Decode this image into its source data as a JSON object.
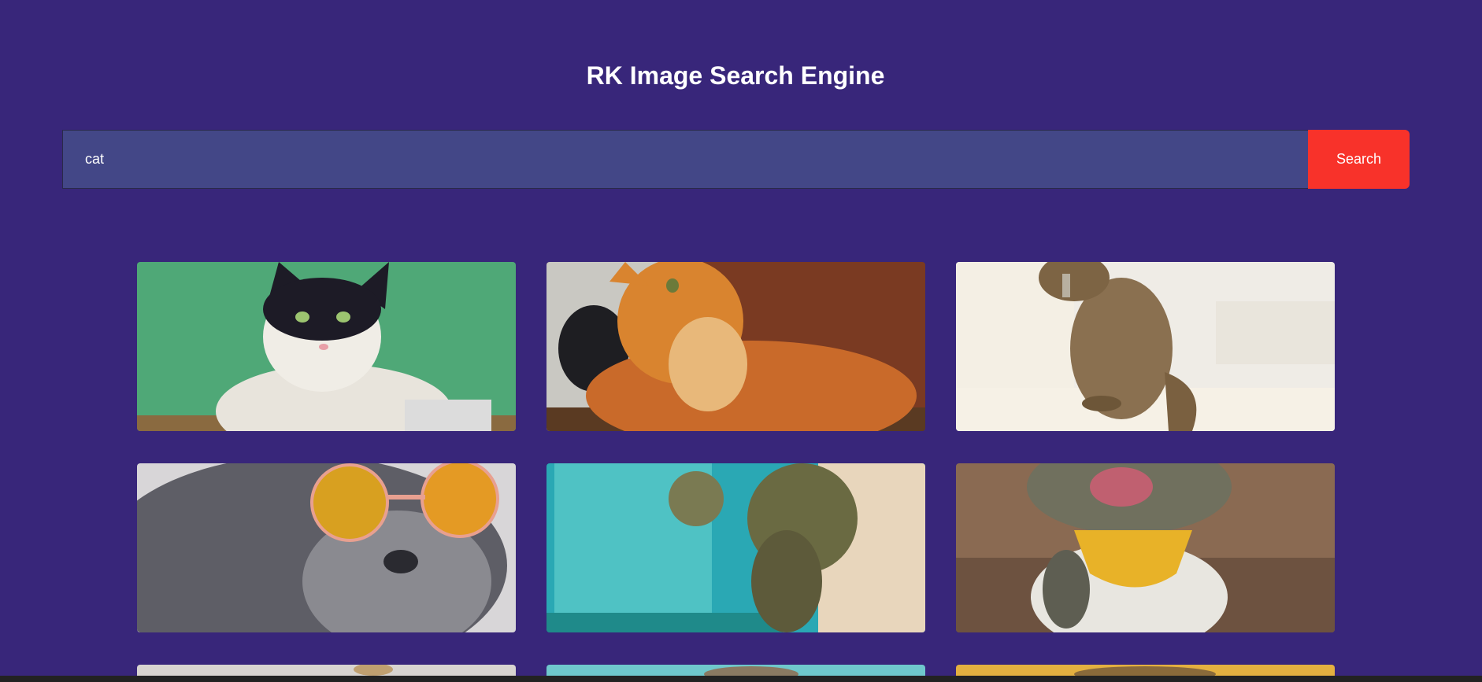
{
  "header": {
    "title": "RK Image Search Engine"
  },
  "search": {
    "value": "cat",
    "button_label": "Search"
  },
  "colors": {
    "background": "#38267a",
    "input_bg": "#434787",
    "button": "#f8322a"
  },
  "results": [
    {
      "subject": "black-and-white cat on green background"
    },
    {
      "subject": "orange tabby cat looking up"
    },
    {
      "subject": "brown tabby cat on stairs"
    },
    {
      "subject": "gray cat wearing sunglasses"
    },
    {
      "subject": "tabby cat peeking by doorway"
    },
    {
      "subject": "cat with yellow bandana"
    },
    {
      "subject": "cat image partially visible"
    },
    {
      "subject": "cat image partially visible"
    },
    {
      "subject": "cat image partially visible"
    }
  ]
}
